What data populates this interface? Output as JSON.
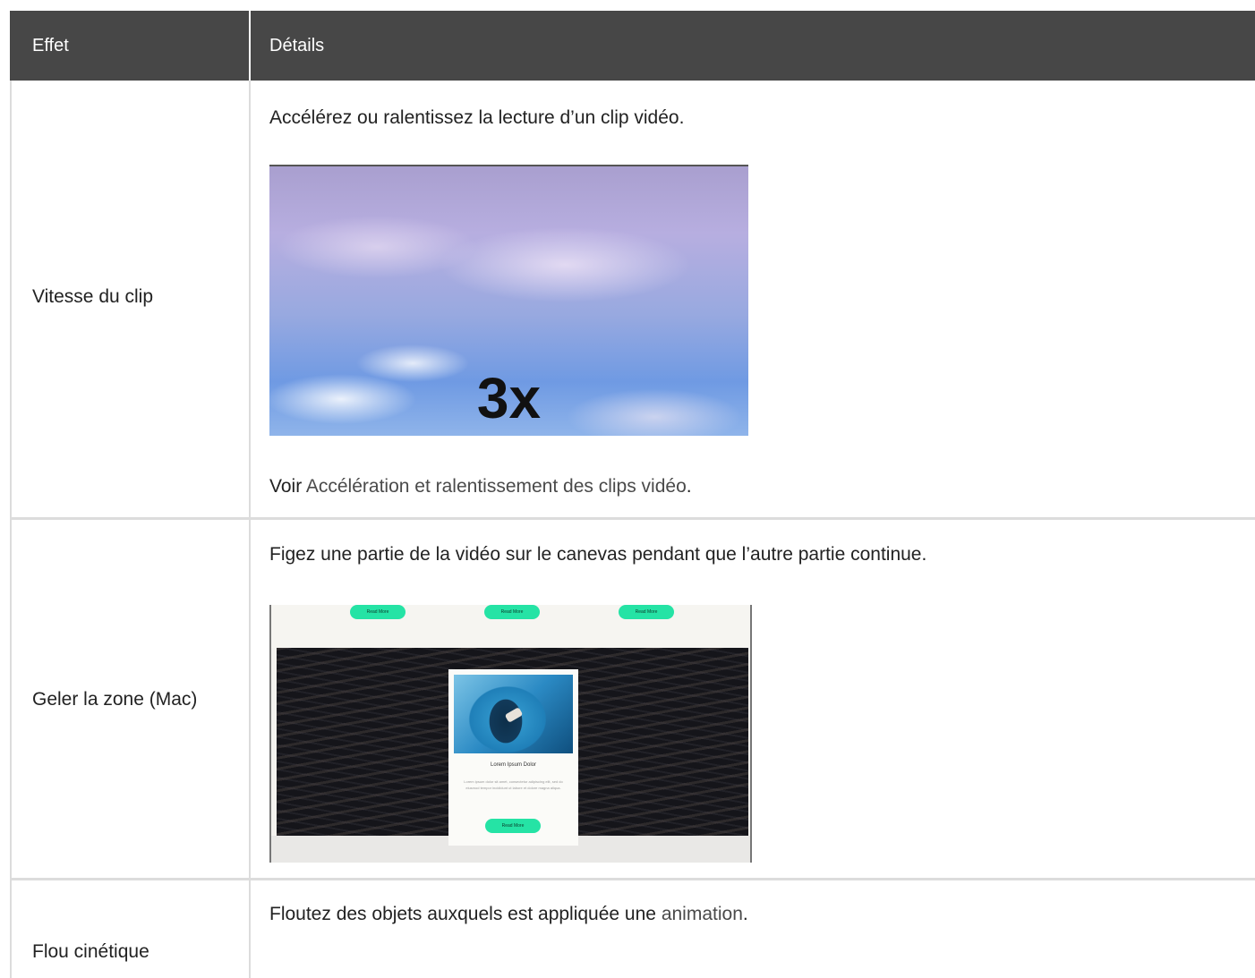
{
  "table": {
    "headers": {
      "effect": "Effet",
      "details": "Détails"
    },
    "rows": [
      {
        "effect": "Vitesse du clip",
        "description": "Accélérez ou ralentissez la lecture d’un clip vidéo.",
        "media_label": "3x",
        "see_prefix": "Voir",
        "see_link": "Accélération et ralentissement des clips vidéo",
        "see_suffix": "."
      },
      {
        "effect": "Geler la zone (Mac)",
        "description": "Figez une partie de la vidéo sur le canevas pendant que l’autre partie continue.",
        "media": {
          "button_label": "Read More",
          "card_title": "Lorem Ipsum Dolor",
          "card_text": "Lorem ipsum dolor sit amet, consectetur adipiscing elit, sed do eiusmod tempor incididunt ut labore et dolore magna aliqua."
        }
      },
      {
        "effect": "Flou cinétique",
        "description_prefix": "Floutez des objets auxquels est appliquée une",
        "description_link": "animation",
        "description_suffix": "."
      }
    ]
  },
  "colors": {
    "header_bg": "#474747",
    "header_text": "#ffffff",
    "divider": "#dcdcdc",
    "text": "#222222",
    "link": "#4a4a4a",
    "accent_green": "#25e3a5"
  }
}
